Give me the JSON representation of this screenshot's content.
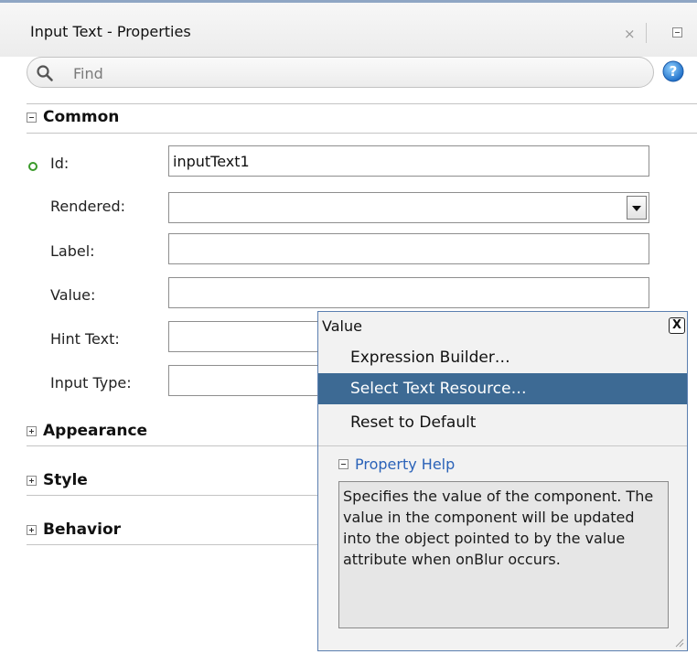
{
  "panel": {
    "title": "Input Text - Properties",
    "close_glyph": "×"
  },
  "search": {
    "placeholder": "Find",
    "value": ""
  },
  "sections": {
    "common": "Common",
    "appearance": "Appearance",
    "style": "Style",
    "behavior": "Behavior"
  },
  "properties": {
    "id_label": "Id:",
    "id_value": "inputText1",
    "rendered_label": "Rendered:",
    "rendered_value": "",
    "label_label": "Label:",
    "label_value": "",
    "value_label": "Value:",
    "value_value": "",
    "hint_label": "Hint Text:",
    "hint_value": "",
    "input_type_label": "Input Type:",
    "input_type_value": ""
  },
  "popup": {
    "title": "Value",
    "close_glyph": "X",
    "menu": {
      "expression_builder": "Expression Builder…",
      "select_text_resource": "Select Text Resource…",
      "reset_to_default": "Reset to Default"
    },
    "help_title": "Property Help",
    "help_text": "Specifies the value of the component. The value in the component will be updated into the object pointed to by the value attribute when onBlur occurs."
  },
  "icons": {
    "search": "search-icon",
    "help": "help-icon",
    "resize": "resize-grip-icon"
  },
  "colors": {
    "selection": "#3d6a94",
    "help_link": "#2a62b8",
    "required_marker": "#3a9a2a",
    "help_button": "#2f7fd6"
  }
}
